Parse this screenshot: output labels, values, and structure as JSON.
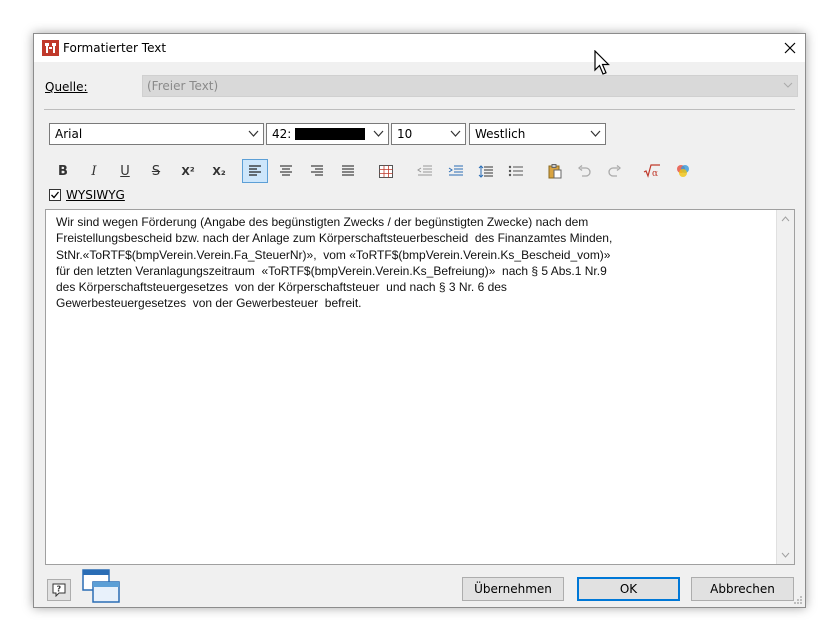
{
  "window": {
    "title": "Formatierter Text"
  },
  "quelle": {
    "label": "Quelle:",
    "value": "(Freier Text)"
  },
  "toolbar": {
    "font": "Arial",
    "style_code": "42:",
    "size": "10",
    "script": "Westlich"
  },
  "format_buttons": {
    "bold": "B",
    "italic": "I",
    "underline": "U",
    "strike": "S",
    "superscript": "X²",
    "subscript": "X₂"
  },
  "wysiwyg": {
    "label": "WYSIWYG",
    "checked": true
  },
  "editor": {
    "lines": [
      "Wir sind wegen Förderung (Angabe des begünstigten Zwecks / der begünstigten Zwecke) nach dem",
      "Freistellungsbescheid bzw. nach der Anlage zum Körperschaftsteuerbescheid  des Finanzamtes Minden,",
      "StNr.«ToRTF$(bmpVerein.Verein.Fa_SteuerNr)»,  vom «ToRTF$(bmpVerein.Verein.Ks_Bescheid_vom)»",
      "für den letzten Veranlagungszeitraum  «ToRTF$(bmpVerein.Verein.Ks_Befreiung)»  nach § 5 Abs.1 Nr.9",
      "des Körperschaftsteuergesetzes  von der Körperschaftsteuer  und nach § 3 Nr. 6 des",
      "Gewerbesteuergesetzes  von der Gewerbesteuer  befreit."
    ]
  },
  "buttons": {
    "apply": "Übernehmen",
    "ok": "OK",
    "cancel": "Abbrechen"
  },
  "icons": [
    "app-icon",
    "close-icon",
    "chevron-down-icon",
    "align-left-icon",
    "align-center-icon",
    "align-right-icon",
    "justify-icon",
    "table-icon",
    "outdent-icon",
    "indent-icon",
    "line-spacing-icon",
    "bullet-list-icon",
    "paste-icon",
    "undo-icon",
    "redo-icon",
    "formula-icon",
    "color-icon",
    "help-icon",
    "windows-icon"
  ],
  "colors": {
    "accent": "#0078d7",
    "active_button_bg": "#cde6fb"
  }
}
